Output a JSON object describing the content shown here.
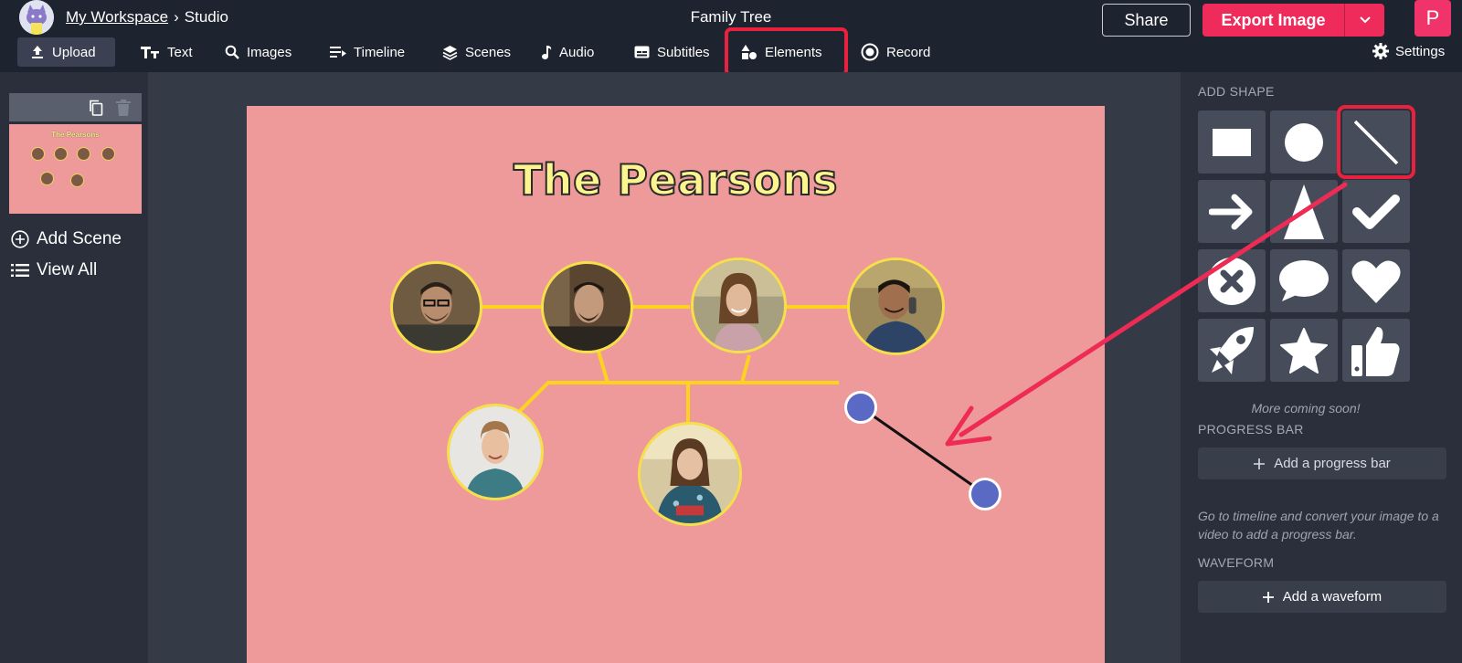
{
  "header": {
    "workspace_link": "My Workspace",
    "separator": "›",
    "studio_label": "Studio",
    "document_title": "Family Tree",
    "share_label": "Share",
    "export_label": "Export Image",
    "avatar_initial": "P"
  },
  "toolbar": {
    "items": [
      {
        "label": "Upload",
        "icon": "upload-icon",
        "active": true
      },
      {
        "label": "Text",
        "icon": "text-icon"
      },
      {
        "label": "Images",
        "icon": "search-icon"
      },
      {
        "label": "Timeline",
        "icon": "timeline-icon"
      },
      {
        "label": "Scenes",
        "icon": "layers-icon"
      },
      {
        "label": "Audio",
        "icon": "music-note-icon"
      },
      {
        "label": "Subtitles",
        "icon": "subtitles-icon"
      },
      {
        "label": "Elements",
        "icon": "shapes-icon",
        "highlighted": true
      },
      {
        "label": "Record",
        "icon": "record-icon"
      }
    ],
    "settings_label": "Settings"
  },
  "left_panel": {
    "scene_thumbnail_title": "The Pearsons",
    "add_scene_label": "Add Scene",
    "view_all_label": "View All"
  },
  "canvas": {
    "title": "The Pearsons",
    "background_color": "#ee9a9a",
    "line_color": "#ffd21f"
  },
  "right_panel": {
    "add_shape_heading": "ADD SHAPE",
    "shapes": [
      "rectangle",
      "circle",
      "line",
      "arrow",
      "triangle",
      "checkmark",
      "x-circle",
      "speech-bubble",
      "heart",
      "rocket",
      "star",
      "thumbs-up"
    ],
    "highlighted_shape": "line",
    "coming_soon": "More coming soon!",
    "progress_bar_heading": "PROGRESS BAR",
    "add_progress_bar_label": "Add a progress bar",
    "progress_hint": "Go to timeline and convert your image to a video to add a progress bar.",
    "waveform_heading": "WAVEFORM",
    "add_waveform_label": "Add a waveform"
  },
  "colors": {
    "accent": "#ee2b5a",
    "highlight_box": "#e8213f",
    "handle": "#5a6ac4"
  }
}
